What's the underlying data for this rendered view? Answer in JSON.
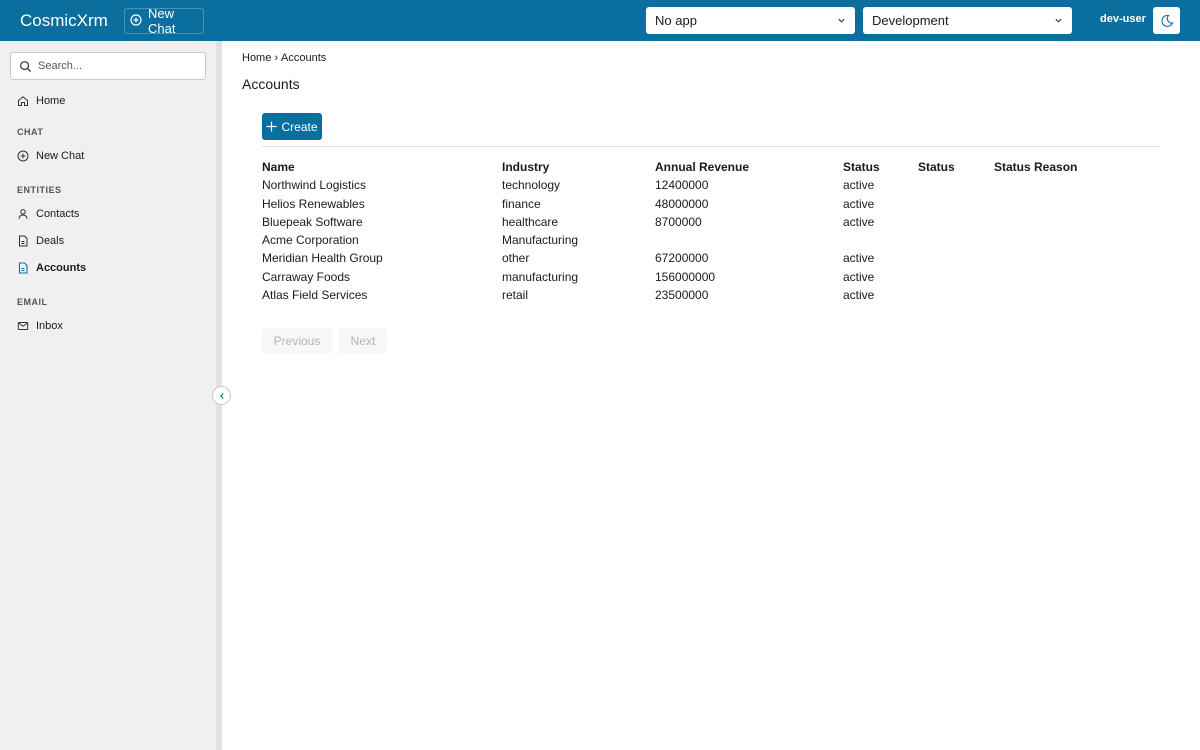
{
  "app": {
    "brand": "CosmicXrm"
  },
  "header": {
    "new_chat_label": "New Chat",
    "app_select": "No app",
    "env_select": "Development",
    "user": "dev-user"
  },
  "sidebar": {
    "search_placeholder": "Search...",
    "home": "Home",
    "sections": {
      "chat": "CHAT",
      "entities": "ENTITIES",
      "email": "EMAIL"
    },
    "items": {
      "new_chat": "New Chat",
      "contacts": "Contacts",
      "deals": "Deals",
      "accounts": "Accounts",
      "inbox": "Inbox"
    },
    "active_item": "accounts"
  },
  "breadcrumb": {
    "home": "Home",
    "separator": "›",
    "current": "Accounts"
  },
  "page": {
    "title": "Accounts",
    "create_label": "Create"
  },
  "table": {
    "columns": [
      "Name",
      "Industry",
      "Annual Revenue",
      "Status",
      "Status",
      "Status Reason"
    ],
    "rows": [
      [
        "Northwind Logistics",
        "technology",
        "12400000",
        "active",
        "",
        ""
      ],
      [
        "Helios Renewables",
        "finance",
        "48000000",
        "active",
        "",
        ""
      ],
      [
        "Bluepeak Software",
        "healthcare",
        "8700000",
        "active",
        "",
        ""
      ],
      [
        "Acme Corporation",
        "Manufacturing",
        "",
        "",
        "",
        ""
      ],
      [
        "Meridian Health Group",
        "other",
        "67200000",
        "active",
        "",
        ""
      ],
      [
        "Carraway Foods",
        "manufacturing",
        "156000000",
        "active",
        "",
        ""
      ],
      [
        "Atlas Field Services",
        "retail",
        "23500000",
        "active",
        "",
        ""
      ]
    ]
  },
  "pager": {
    "previous": "Previous",
    "next": "Next"
  },
  "colors": {
    "brand": "#0a6e9e",
    "sidebar_bg": "#f0f0f0"
  }
}
